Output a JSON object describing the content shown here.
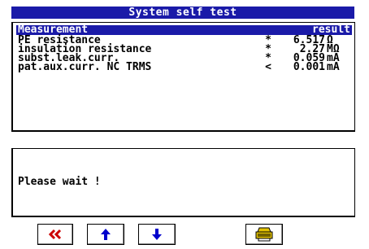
{
  "window": {
    "title": "System self test"
  },
  "results": {
    "header": {
      "measurement": "Measurement",
      "result": "result"
    },
    "rows": [
      {
        "name": "PE resistance",
        "flag": "*",
        "value": "6.517",
        "unit": "Ω"
      },
      {
        "name": "insulation resistance",
        "flag": "*",
        "value": "2.27",
        "unit": "MΩ"
      },
      {
        "name": "subst.leak.curr.",
        "flag": "*",
        "value": "0.059",
        "unit": "mA"
      },
      {
        "name": "pat.aux.curr. NC TRMS",
        "flag": "<",
        "value": "0.001",
        "unit": "mA"
      }
    ]
  },
  "message": {
    "text": "Please wait !"
  },
  "toolbar": {
    "back_icon": "double-chevron-left-icon",
    "up_icon": "arrow-up-icon",
    "down_icon": "arrow-down-icon",
    "print_icon": "printer-icon",
    "colors": {
      "back": "#cc0000",
      "arrows": "#0000cc",
      "print": "#e0c000"
    }
  },
  "colors": {
    "accent": "#1a1aa8"
  }
}
